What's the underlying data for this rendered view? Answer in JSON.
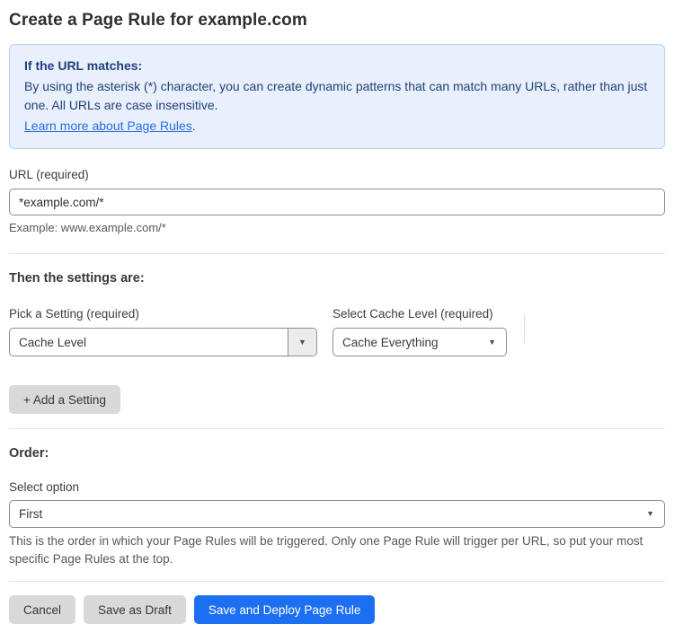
{
  "page": {
    "title": "Create a Page Rule for example.com"
  },
  "info_box": {
    "heading": "If the URL matches:",
    "body": "By using the asterisk (*) character, you can create dynamic patterns that can match many URLs, rather than just one. All URLs are case insensitive.",
    "link_label": "Learn more about Page Rules",
    "link_suffix": "."
  },
  "url_field": {
    "label": "URL (required)",
    "value": "*example.com/*",
    "helper": "Example: www.example.com/*"
  },
  "settings_section": {
    "heading": "Then the settings are:",
    "setting_picker": {
      "label": "Pick a Setting (required)",
      "value": "Cache Level"
    },
    "cache_level_picker": {
      "label": "Select Cache Level (required)",
      "value": "Cache Everything"
    },
    "add_setting_label": "+ Add a Setting"
  },
  "order_section": {
    "heading": "Order:",
    "label": "Select option",
    "value": "First",
    "helper": "This is the order in which your Page Rules will be triggered. Only one Page Rule will trigger per URL, so put your most specific Page Rules at the top."
  },
  "actions": {
    "cancel": "Cancel",
    "save_draft": "Save as Draft",
    "save_deploy": "Save and Deploy Page Rule"
  },
  "icons": {
    "dropdown_arrow": "▼"
  },
  "colors": {
    "info_bg": "#e7f0fc",
    "info_border": "#b5d3f2",
    "info_text": "#24407a",
    "link": "#2b6bdf",
    "primary_button": "#1d6ff2",
    "secondary_button": "#d9d9d9"
  }
}
